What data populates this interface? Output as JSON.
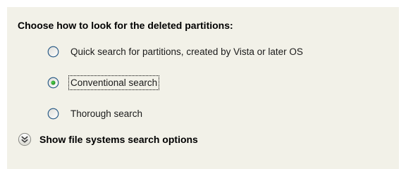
{
  "heading": "Choose how to look for the deleted partitions:",
  "search_options": [
    {
      "label": "Quick search for partitions, created by Vista or later OS",
      "selected": false
    },
    {
      "label": "Conventional search",
      "selected": true
    },
    {
      "label": "Thorough search",
      "selected": false
    }
  ],
  "expander": {
    "label": "Show file systems search options",
    "icon": "double-chevron-down-icon"
  },
  "colors": {
    "panel_background": "#f2f1e8",
    "radio_dot": "#2aa12a",
    "radio_border": "#1c5180"
  }
}
